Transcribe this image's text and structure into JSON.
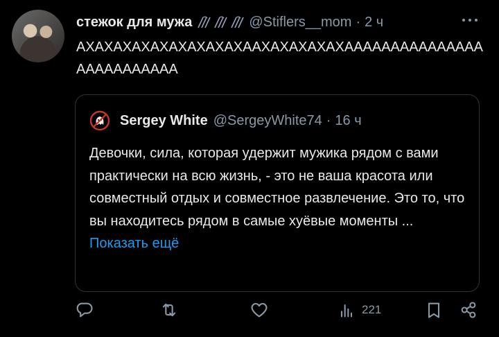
{
  "post": {
    "author_name": "стежок для мужа",
    "handle": "@Stiflers__mom",
    "separator": "·",
    "time": "2 ч",
    "text": "АХАХАХАХАХАХАХАХАХААХАХАХАХАХАААААААААААААААААААААААААА"
  },
  "quote": {
    "author_name": "Sergey White",
    "handle": "@SergeyWhite74",
    "separator": "·",
    "time": "16 ч",
    "text": "Девочки, сила, которая удержит мужика рядом с вами практически на всю жизнь, - это не ваша красота или совместный отдых и совместное развлечение. Это то, что вы находитесь рядом в самые хуёвые моменты ...",
    "show_more": "Показать ещё"
  },
  "actions": {
    "views_count": "221"
  },
  "icons": {
    "more": "more-horizontal-icon",
    "reply": "reply-icon",
    "repost": "repost-icon",
    "like": "heart-icon",
    "views": "analytics-icon",
    "bookmark": "bookmark-icon",
    "share": "share-icon"
  },
  "colors": {
    "background": "#000000",
    "text": "#e7e9ea",
    "secondary": "#8b98a5",
    "link": "#1d9bf0",
    "border": "#2f3336"
  }
}
